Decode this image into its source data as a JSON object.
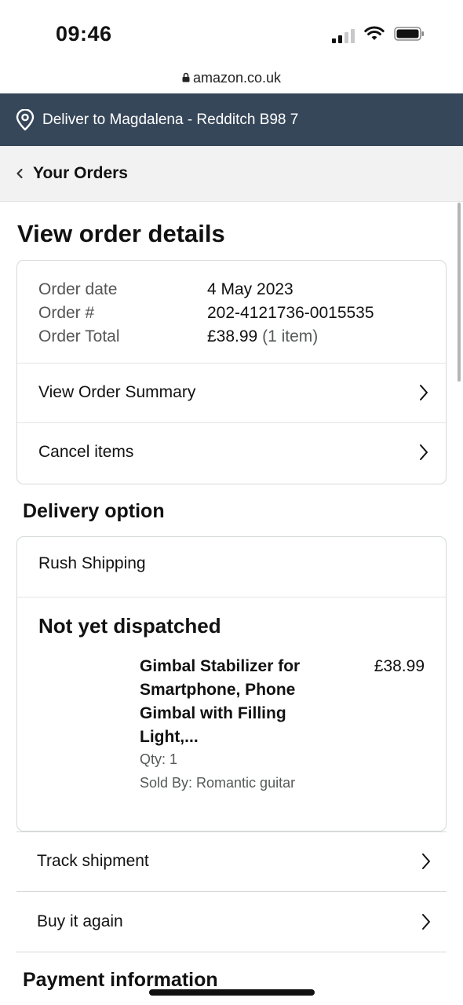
{
  "status_bar": {
    "time": "09:46"
  },
  "browser": {
    "url": "amazon.co.uk"
  },
  "delivery_banner": {
    "text": "Deliver to Magdalena - Redditch B98 7"
  },
  "nav": {
    "back_label": "Your Orders"
  },
  "page": {
    "title": "View order details"
  },
  "order": {
    "rows": [
      {
        "key": "Order date",
        "value": "4 May 2023",
        "extra": ""
      },
      {
        "key": "Order #",
        "value": "202-4121736-0015535",
        "extra": ""
      },
      {
        "key": "Order Total",
        "value": "£38.99",
        "extra": "(1 item)"
      }
    ],
    "view_summary_label": "View Order Summary",
    "cancel_label": "Cancel items"
  },
  "delivery": {
    "section_title": "Delivery option",
    "option": "Rush Shipping",
    "status": "Not yet dispatched",
    "product": {
      "title": "Gimbal Stabilizer for Smartphone, Phone Gimbal with Filling Light,...",
      "price": "£38.99",
      "qty": "Qty: 1",
      "seller": "Sold By: Romantic guitar"
    }
  },
  "actions": {
    "track_label": "Track shipment",
    "buy_again_label": "Buy it again"
  },
  "payment": {
    "section_title": "Payment information"
  },
  "colors": {
    "banner": "#37475a",
    "border": "#d5d9d9"
  },
  "icons": [
    "signal-icon",
    "wifi-icon",
    "battery-icon",
    "lock-icon",
    "location-pin-icon",
    "chevron-left-icon",
    "chevron-right-icon"
  ]
}
